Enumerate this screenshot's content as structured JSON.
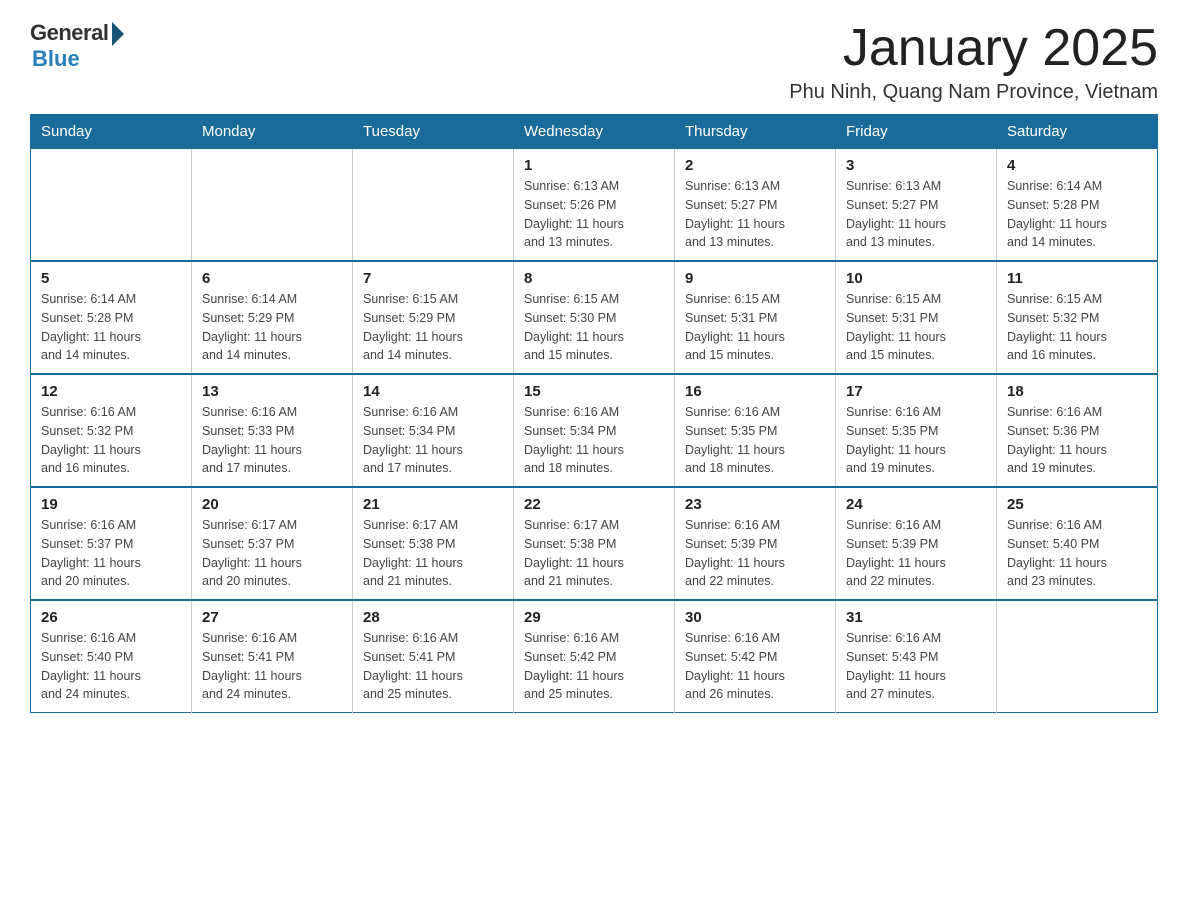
{
  "logo": {
    "general": "General",
    "blue": "Blue",
    "subtitle": "Blue"
  },
  "title": "January 2025",
  "location": "Phu Ninh, Quang Nam Province, Vietnam",
  "days_of_week": [
    "Sunday",
    "Monday",
    "Tuesday",
    "Wednesday",
    "Thursday",
    "Friday",
    "Saturday"
  ],
  "weeks": [
    [
      {
        "day": "",
        "info": ""
      },
      {
        "day": "",
        "info": ""
      },
      {
        "day": "",
        "info": ""
      },
      {
        "day": "1",
        "info": "Sunrise: 6:13 AM\nSunset: 5:26 PM\nDaylight: 11 hours\nand 13 minutes."
      },
      {
        "day": "2",
        "info": "Sunrise: 6:13 AM\nSunset: 5:27 PM\nDaylight: 11 hours\nand 13 minutes."
      },
      {
        "day": "3",
        "info": "Sunrise: 6:13 AM\nSunset: 5:27 PM\nDaylight: 11 hours\nand 13 minutes."
      },
      {
        "day": "4",
        "info": "Sunrise: 6:14 AM\nSunset: 5:28 PM\nDaylight: 11 hours\nand 14 minutes."
      }
    ],
    [
      {
        "day": "5",
        "info": "Sunrise: 6:14 AM\nSunset: 5:28 PM\nDaylight: 11 hours\nand 14 minutes."
      },
      {
        "day": "6",
        "info": "Sunrise: 6:14 AM\nSunset: 5:29 PM\nDaylight: 11 hours\nand 14 minutes."
      },
      {
        "day": "7",
        "info": "Sunrise: 6:15 AM\nSunset: 5:29 PM\nDaylight: 11 hours\nand 14 minutes."
      },
      {
        "day": "8",
        "info": "Sunrise: 6:15 AM\nSunset: 5:30 PM\nDaylight: 11 hours\nand 15 minutes."
      },
      {
        "day": "9",
        "info": "Sunrise: 6:15 AM\nSunset: 5:31 PM\nDaylight: 11 hours\nand 15 minutes."
      },
      {
        "day": "10",
        "info": "Sunrise: 6:15 AM\nSunset: 5:31 PM\nDaylight: 11 hours\nand 15 minutes."
      },
      {
        "day": "11",
        "info": "Sunrise: 6:15 AM\nSunset: 5:32 PM\nDaylight: 11 hours\nand 16 minutes."
      }
    ],
    [
      {
        "day": "12",
        "info": "Sunrise: 6:16 AM\nSunset: 5:32 PM\nDaylight: 11 hours\nand 16 minutes."
      },
      {
        "day": "13",
        "info": "Sunrise: 6:16 AM\nSunset: 5:33 PM\nDaylight: 11 hours\nand 17 minutes."
      },
      {
        "day": "14",
        "info": "Sunrise: 6:16 AM\nSunset: 5:34 PM\nDaylight: 11 hours\nand 17 minutes."
      },
      {
        "day": "15",
        "info": "Sunrise: 6:16 AM\nSunset: 5:34 PM\nDaylight: 11 hours\nand 18 minutes."
      },
      {
        "day": "16",
        "info": "Sunrise: 6:16 AM\nSunset: 5:35 PM\nDaylight: 11 hours\nand 18 minutes."
      },
      {
        "day": "17",
        "info": "Sunrise: 6:16 AM\nSunset: 5:35 PM\nDaylight: 11 hours\nand 19 minutes."
      },
      {
        "day": "18",
        "info": "Sunrise: 6:16 AM\nSunset: 5:36 PM\nDaylight: 11 hours\nand 19 minutes."
      }
    ],
    [
      {
        "day": "19",
        "info": "Sunrise: 6:16 AM\nSunset: 5:37 PM\nDaylight: 11 hours\nand 20 minutes."
      },
      {
        "day": "20",
        "info": "Sunrise: 6:17 AM\nSunset: 5:37 PM\nDaylight: 11 hours\nand 20 minutes."
      },
      {
        "day": "21",
        "info": "Sunrise: 6:17 AM\nSunset: 5:38 PM\nDaylight: 11 hours\nand 21 minutes."
      },
      {
        "day": "22",
        "info": "Sunrise: 6:17 AM\nSunset: 5:38 PM\nDaylight: 11 hours\nand 21 minutes."
      },
      {
        "day": "23",
        "info": "Sunrise: 6:16 AM\nSunset: 5:39 PM\nDaylight: 11 hours\nand 22 minutes."
      },
      {
        "day": "24",
        "info": "Sunrise: 6:16 AM\nSunset: 5:39 PM\nDaylight: 11 hours\nand 22 minutes."
      },
      {
        "day": "25",
        "info": "Sunrise: 6:16 AM\nSunset: 5:40 PM\nDaylight: 11 hours\nand 23 minutes."
      }
    ],
    [
      {
        "day": "26",
        "info": "Sunrise: 6:16 AM\nSunset: 5:40 PM\nDaylight: 11 hours\nand 24 minutes."
      },
      {
        "day": "27",
        "info": "Sunrise: 6:16 AM\nSunset: 5:41 PM\nDaylight: 11 hours\nand 24 minutes."
      },
      {
        "day": "28",
        "info": "Sunrise: 6:16 AM\nSunset: 5:41 PM\nDaylight: 11 hours\nand 25 minutes."
      },
      {
        "day": "29",
        "info": "Sunrise: 6:16 AM\nSunset: 5:42 PM\nDaylight: 11 hours\nand 25 minutes."
      },
      {
        "day": "30",
        "info": "Sunrise: 6:16 AM\nSunset: 5:42 PM\nDaylight: 11 hours\nand 26 minutes."
      },
      {
        "day": "31",
        "info": "Sunrise: 6:16 AM\nSunset: 5:43 PM\nDaylight: 11 hours\nand 27 minutes."
      },
      {
        "day": "",
        "info": ""
      }
    ]
  ]
}
